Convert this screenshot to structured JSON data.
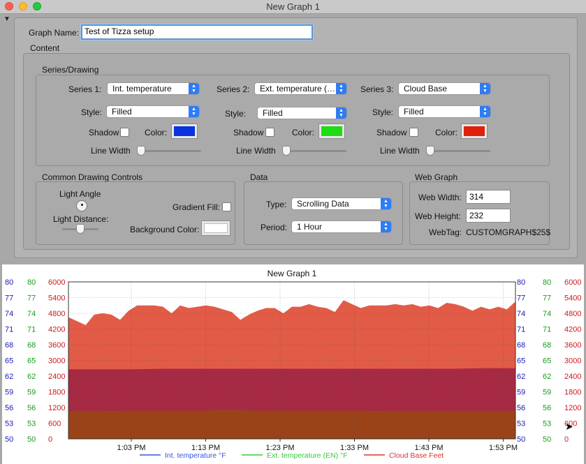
{
  "window": {
    "title": "New Graph 1"
  },
  "form": {
    "graph_name_label": "Graph Name:",
    "graph_name_value": "Test of Tizza setup",
    "content_label": "Content",
    "series_drawing_label": "Series/Drawing",
    "series": [
      {
        "label": "Series 1:",
        "value": "Int. temperature",
        "style_label": "Style:",
        "style_value": "Filled",
        "shadow_label": "Shadow",
        "color_label": "Color:",
        "color": "#0a33e0",
        "line_width_label": "Line Width"
      },
      {
        "label": "Series 2:",
        "value": "Ext. temperature (…",
        "style_label": "Style:",
        "style_value": "Filled",
        "shadow_label": "Shadow",
        "color_label": "Color:",
        "color": "#1edc12",
        "line_width_label": "Line Width"
      },
      {
        "label": "Series 3:",
        "value": "Cloud Base",
        "style_label": "Style:",
        "style_value": "Filled",
        "shadow_label": "Shadow",
        "color_label": "Color:",
        "color": "#e0200d",
        "line_width_label": "Line Width"
      }
    ],
    "common": {
      "title": "Common Drawing Controls",
      "light_angle_label": "Light Angle",
      "light_distance_label": "Light Distance:",
      "gradient_fill_label": "Gradient Fill:",
      "background_color_label": "Background Color:",
      "background_color": "#ffffff"
    },
    "data": {
      "title": "Data",
      "type_label": "Type:",
      "type_value": "Scrolling Data",
      "period_label": "Period:",
      "period_value": "1 Hour"
    },
    "web": {
      "title": "Web Graph",
      "width_label": "Web Width:",
      "width_value": "314",
      "height_label": "Web Height:",
      "height_value": "232",
      "tag_label": "WebTag:",
      "tag_value": "CUSTOMGRAPH$25$"
    }
  },
  "chart_data": {
    "type": "area",
    "title": "New Graph 1",
    "x_ticks": [
      "1:03 PM",
      "1:13 PM",
      "1:23 PM",
      "1:33 PM",
      "1:43 PM",
      "1:53 PM"
    ],
    "y_axes": [
      {
        "color": "#1a1ab8",
        "ticks": [
          "80",
          "77",
          "74",
          "71",
          "68",
          "65",
          "62",
          "59",
          "56",
          "53",
          "50"
        ]
      },
      {
        "color": "#1a9a1a",
        "ticks": [
          "80",
          "77",
          "74",
          "71",
          "68",
          "65",
          "62",
          "59",
          "56",
          "53",
          "50"
        ]
      },
      {
        "color": "#cc1a1a",
        "ticks": [
          "6000",
          "5400",
          "4800",
          "4200",
          "3600",
          "3000",
          "2400",
          "1800",
          "1200",
          "600",
          "0"
        ]
      }
    ],
    "cloud_base_ylim": [
      0,
      6000
    ],
    "temp_ylim": [
      50,
      80
    ],
    "cloud_base": [
      4650,
      4500,
      4350,
      4750,
      4800,
      4750,
      4550,
      4900,
      5100,
      5100,
      5100,
      5050,
      4800,
      5100,
      5000,
      5050,
      5100,
      5050,
      4950,
      4850,
      4550,
      4750,
      4900,
      5000,
      5000,
      4800,
      5050,
      5050,
      5150,
      5050,
      5000,
      4850,
      5300,
      5150,
      5000,
      5100,
      5100,
      5100,
      5150,
      5100,
      5150,
      5050,
      5100,
      5000,
      5200,
      5150,
      5050,
      4900,
      5050,
      4950,
      5050,
      4950,
      5250
    ],
    "int_temperature": [
      63.3,
      63.3,
      63.3,
      63.4,
      63.4,
      63.4,
      63.4,
      63.4,
      63.4,
      63.4,
      63.4,
      63.4,
      63.4,
      63.5,
      63.5
    ],
    "ext_temperature": [
      55.3,
      55.3,
      55.4,
      55.4,
      55.4,
      55.5,
      55.4,
      55.4,
      55.4,
      55.4,
      55.3,
      55.3,
      55.3,
      55.3,
      55.3
    ],
    "legend": [
      {
        "name": "Int. temperature °F",
        "color": "#3355dd"
      },
      {
        "name": "Ext. temperature (EN) °F",
        "color": "#33cc33"
      },
      {
        "name": "Cloud Base Feet",
        "color": "#dd3333"
      }
    ]
  }
}
